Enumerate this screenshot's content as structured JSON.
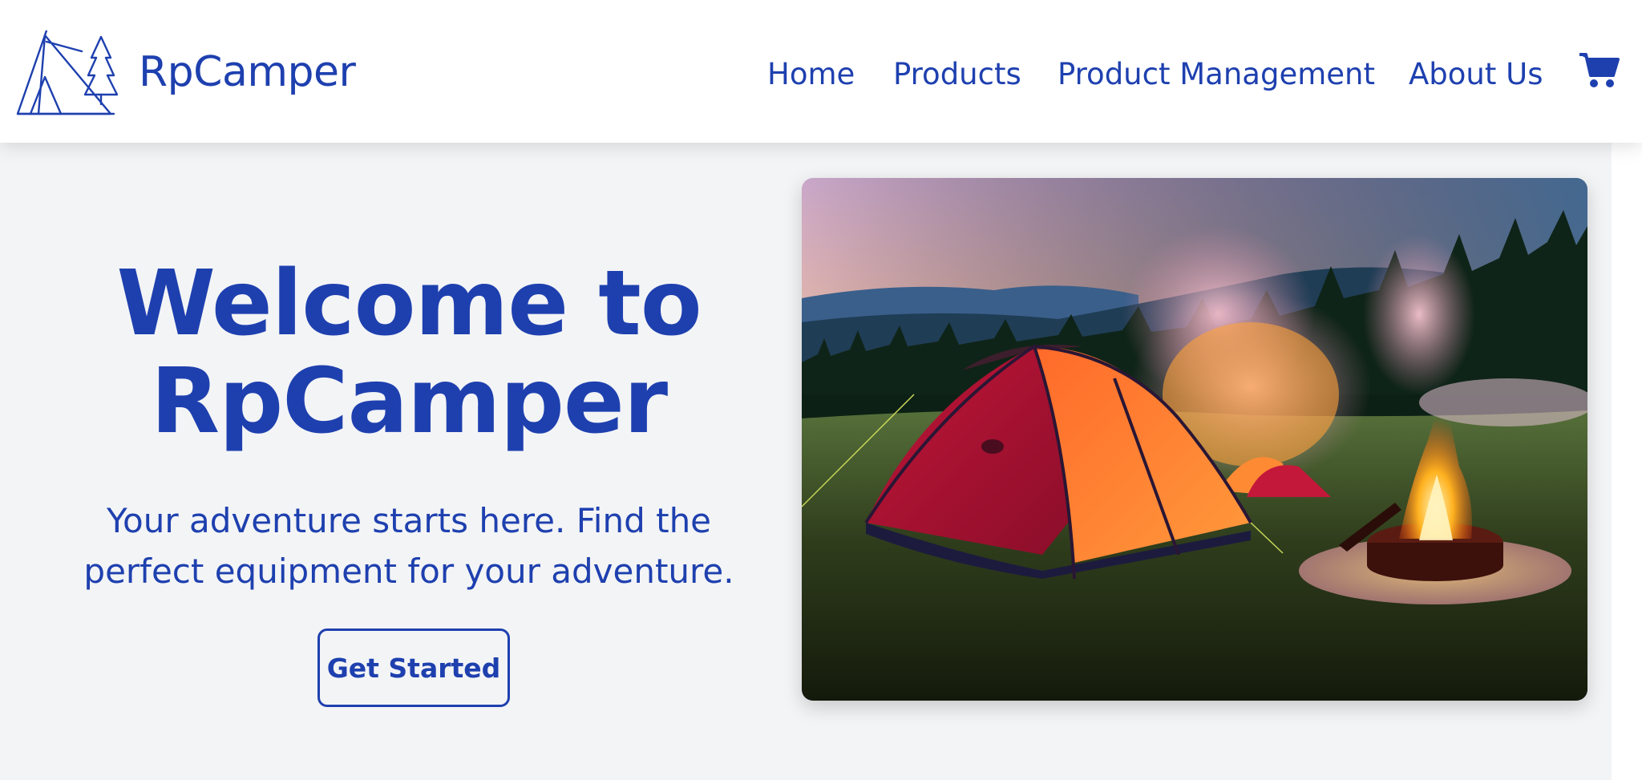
{
  "brand": {
    "name": "RpCamper",
    "logo_icon": "tent-and-trees-logo"
  },
  "nav": {
    "items": [
      {
        "label": "Home"
      },
      {
        "label": "Products"
      },
      {
        "label": "Product Management"
      },
      {
        "label": "About Us"
      }
    ],
    "cart_icon": "shopping-cart-icon"
  },
  "hero": {
    "title": "Welcome to RpCamper",
    "subtitle": "Your adventure starts here. Find the perfect equipment for your adventure.",
    "cta_label": "Get Started",
    "image_subject": "camping-tent-campfire-at-dusk"
  },
  "colors": {
    "brand": "#1e40af",
    "page_background": "#f3f4f6",
    "header_background": "#ffffff"
  }
}
